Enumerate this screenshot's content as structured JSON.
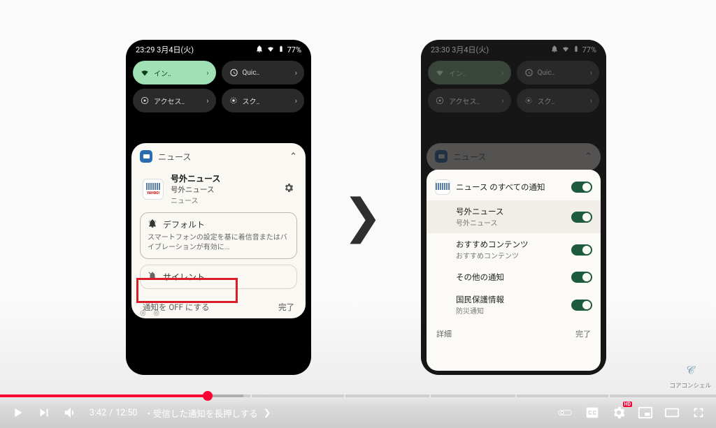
{
  "left_phone": {
    "time": "23:29",
    "date": "3月4日(火)",
    "battery": "77%",
    "qs": [
      {
        "label": "イン‥",
        "active": true,
        "icon": "wifi"
      },
      {
        "label": "Quic‥",
        "active": false,
        "icon": "history"
      },
      {
        "label": "アクセス‥",
        "active": false,
        "icon": "access"
      },
      {
        "label": "スク‥",
        "active": false,
        "icon": "screen"
      }
    ],
    "card": {
      "group": "ニュース",
      "title": "号外ニュース",
      "line2": "号外ニュース",
      "line3": "ニュース",
      "default_label": "デフォルト",
      "default_desc": "スマートフォンの設定を基に着信音またはバイブレーションが有効に...",
      "silent_label": "サイレント",
      "off_label": "通知を OFF にする",
      "done_label": "完了"
    }
  },
  "right_phone": {
    "time": "23:30",
    "date": "3月4日(火)",
    "battery": "77%",
    "qs": [
      {
        "label": "イン‥",
        "active": true,
        "icon": "wifi"
      },
      {
        "label": "Quic‥",
        "active": false,
        "icon": "history"
      },
      {
        "label": "アクセス‥",
        "active": false,
        "icon": "access"
      },
      {
        "label": "スク‥",
        "active": false,
        "icon": "screen"
      }
    ],
    "card_header": "ニュース",
    "rows": [
      {
        "title": "ニュース のすべての通知",
        "sub": ""
      },
      {
        "title": "号外ニュース",
        "sub": "号外ニュース",
        "active": true
      },
      {
        "title": "おすすめコンテンツ",
        "sub": "おすすめコンテンツ"
      },
      {
        "title": "その他の通知",
        "sub": ""
      },
      {
        "title": "国民保護情報",
        "sub": "防災通知"
      }
    ],
    "detail_label": "詳細",
    "done_label": "完了"
  },
  "arrow": "❯",
  "watermark": "コアコンシェル",
  "player": {
    "current": "3:42",
    "total": "12:50",
    "chapter": "・受信した通知を長押しする",
    "chapter_chevron": "❯",
    "hd": "HD",
    "chapter_marks_pct": [
      8,
      14,
      20,
      35,
      48,
      60,
      72,
      85
    ]
  }
}
